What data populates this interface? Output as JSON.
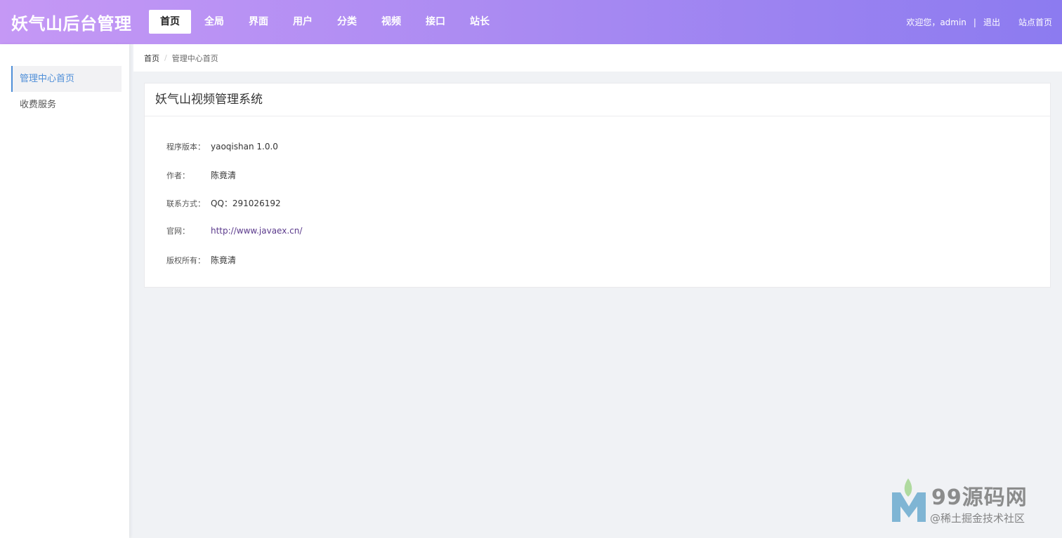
{
  "header": {
    "brand": "妖气山后台管理",
    "nav": [
      {
        "label": "首页",
        "active": true
      },
      {
        "label": "全局",
        "active": false
      },
      {
        "label": "界面",
        "active": false
      },
      {
        "label": "用户",
        "active": false
      },
      {
        "label": "分类",
        "active": false
      },
      {
        "label": "视频",
        "active": false
      },
      {
        "label": "接口",
        "active": false
      },
      {
        "label": "站长",
        "active": false
      }
    ],
    "welcome": "欢迎您，admin",
    "separator": "|",
    "logout": "退出",
    "site_home": "站点首页",
    "gradient_start": "#c598f5",
    "gradient_end": "#8c7bf0"
  },
  "sidebar": {
    "items": [
      {
        "label": "管理中心首页",
        "active": true
      },
      {
        "label": "收费服务",
        "active": false
      }
    ],
    "accent": "#4f8fd8"
  },
  "breadcrumb": {
    "home": "首页",
    "separator": "/",
    "current": "管理中心首页"
  },
  "card": {
    "title": "妖气山视频管理系统",
    "rows": [
      {
        "label": "程序版本：",
        "value": "yaoqishan 1.0.0"
      },
      {
        "label": "作者：",
        "value": "陈竟清"
      },
      {
        "label": "联系方式：",
        "value": "QQ：291026192"
      },
      {
        "label": "官网：",
        "value": "http://www.javaex.cn/"
      },
      {
        "label": "版权所有：",
        "value": "陈竟清"
      }
    ]
  },
  "watermark": {
    "text": "99源码网",
    "sub": "@稀土掘金技术社区"
  }
}
